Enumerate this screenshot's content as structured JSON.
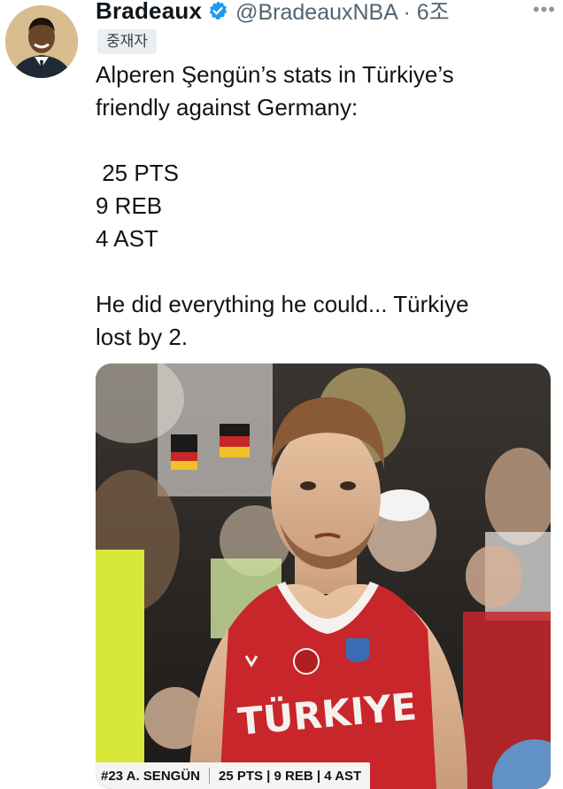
{
  "tweet": {
    "author_name": "Bradeaux",
    "handle_time": "@BradeauxNBA · 6조",
    "badge": "중재자",
    "more_icon": "more-dots-icon",
    "lines": [
      "Alperen Şengün’s stats in Türkiye’s",
      "friendly against Germany:",
      "",
      " 25 PTS",
      "9 REB",
      "4 AST",
      "",
      "He did everything he could... Türkiye",
      "lost by 2."
    ]
  },
  "media": {
    "jersey_text": "TÜRKIYE",
    "scorebar": {
      "player": "#23 A. SENGÜN",
      "stats": "25 PTS | 9 REB | 4 AST"
    }
  },
  "colors": {
    "verified": "#1d9bf0",
    "jersey_red": "#c8262b",
    "handle_gray": "#536471"
  }
}
